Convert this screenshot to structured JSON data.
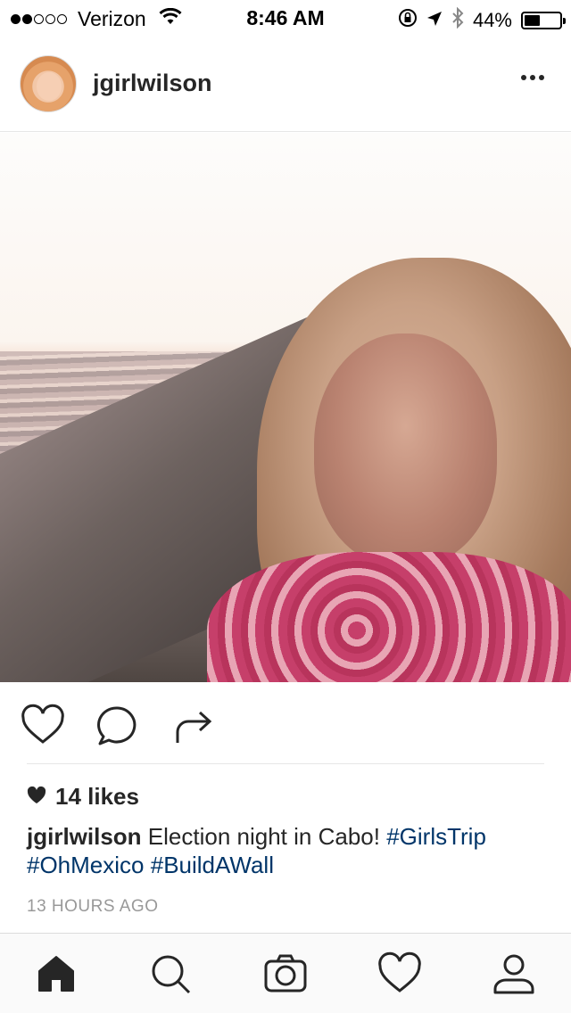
{
  "status_bar": {
    "carrier": "Verizon",
    "signal_bars": 2,
    "signal_total": 5,
    "time": "8:46 AM",
    "battery_percent": "44%",
    "battery_level": 0.44
  },
  "post": {
    "username": "jgirlwilson",
    "likes": "14 likes",
    "caption_user": "jgirlwilson",
    "caption_text": " Election night in Cabo! ",
    "hashtags": [
      "#GirlsTrip",
      "#OhMexico",
      "#BuildAWall"
    ],
    "timestamp": "13 HOURS AGO"
  },
  "icons": {
    "more": "more-options-icon",
    "like": "heart-outline-icon",
    "comment": "comment-bubble-icon",
    "share": "share-arrow-icon",
    "tabs": [
      "home-icon",
      "search-icon",
      "camera-icon",
      "activity-heart-icon",
      "profile-icon"
    ]
  }
}
